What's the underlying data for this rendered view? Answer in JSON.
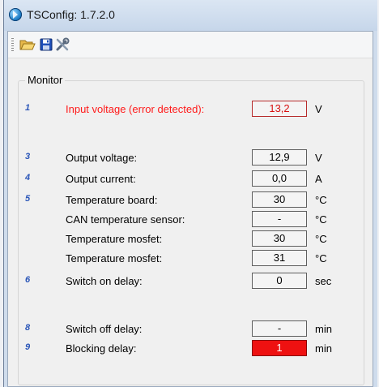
{
  "window": {
    "title": "TSConfig: 1.7.2.0"
  },
  "toolbar": {
    "items": [
      {
        "name": "open",
        "icon": "open-folder-icon"
      },
      {
        "name": "save",
        "icon": "save-disk-icon"
      },
      {
        "name": "settings",
        "icon": "tools-icon"
      }
    ]
  },
  "monitor": {
    "group_label": "Monitor",
    "rows": [
      {
        "num": "1",
        "label": "Input voltage (error detected):",
        "value": "13,2",
        "unit": "V",
        "state": "error"
      },
      {
        "num": "3",
        "label": "Output voltage:",
        "value": "12,9",
        "unit": "V"
      },
      {
        "num": "4",
        "label": "Output current:",
        "value": "0,0",
        "unit": "A"
      },
      {
        "num": "5",
        "label": "Temperature board:",
        "value": "30",
        "unit": "°C"
      },
      {
        "num": "",
        "label": "CAN temperature sensor:",
        "value": "-",
        "unit": "°C"
      },
      {
        "num": "",
        "label": "Temperature mosfet:",
        "value": "30",
        "unit": "°C"
      },
      {
        "num": "",
        "label": "Temperature mosfet:",
        "value": "31",
        "unit": "°C"
      },
      {
        "num": "6",
        "label": "Switch on delay:",
        "value": "0",
        "unit": "sec"
      },
      {
        "num": "8",
        "label": "Switch off delay:",
        "value": "-",
        "unit": "min"
      },
      {
        "num": "9",
        "label": "Blocking delay:",
        "value": "1",
        "unit": "min",
        "state": "alert"
      }
    ]
  },
  "colors": {
    "error_text": "#ff1a1a",
    "alert_fill": "#ee1111",
    "index_number": "#2b56b8"
  }
}
